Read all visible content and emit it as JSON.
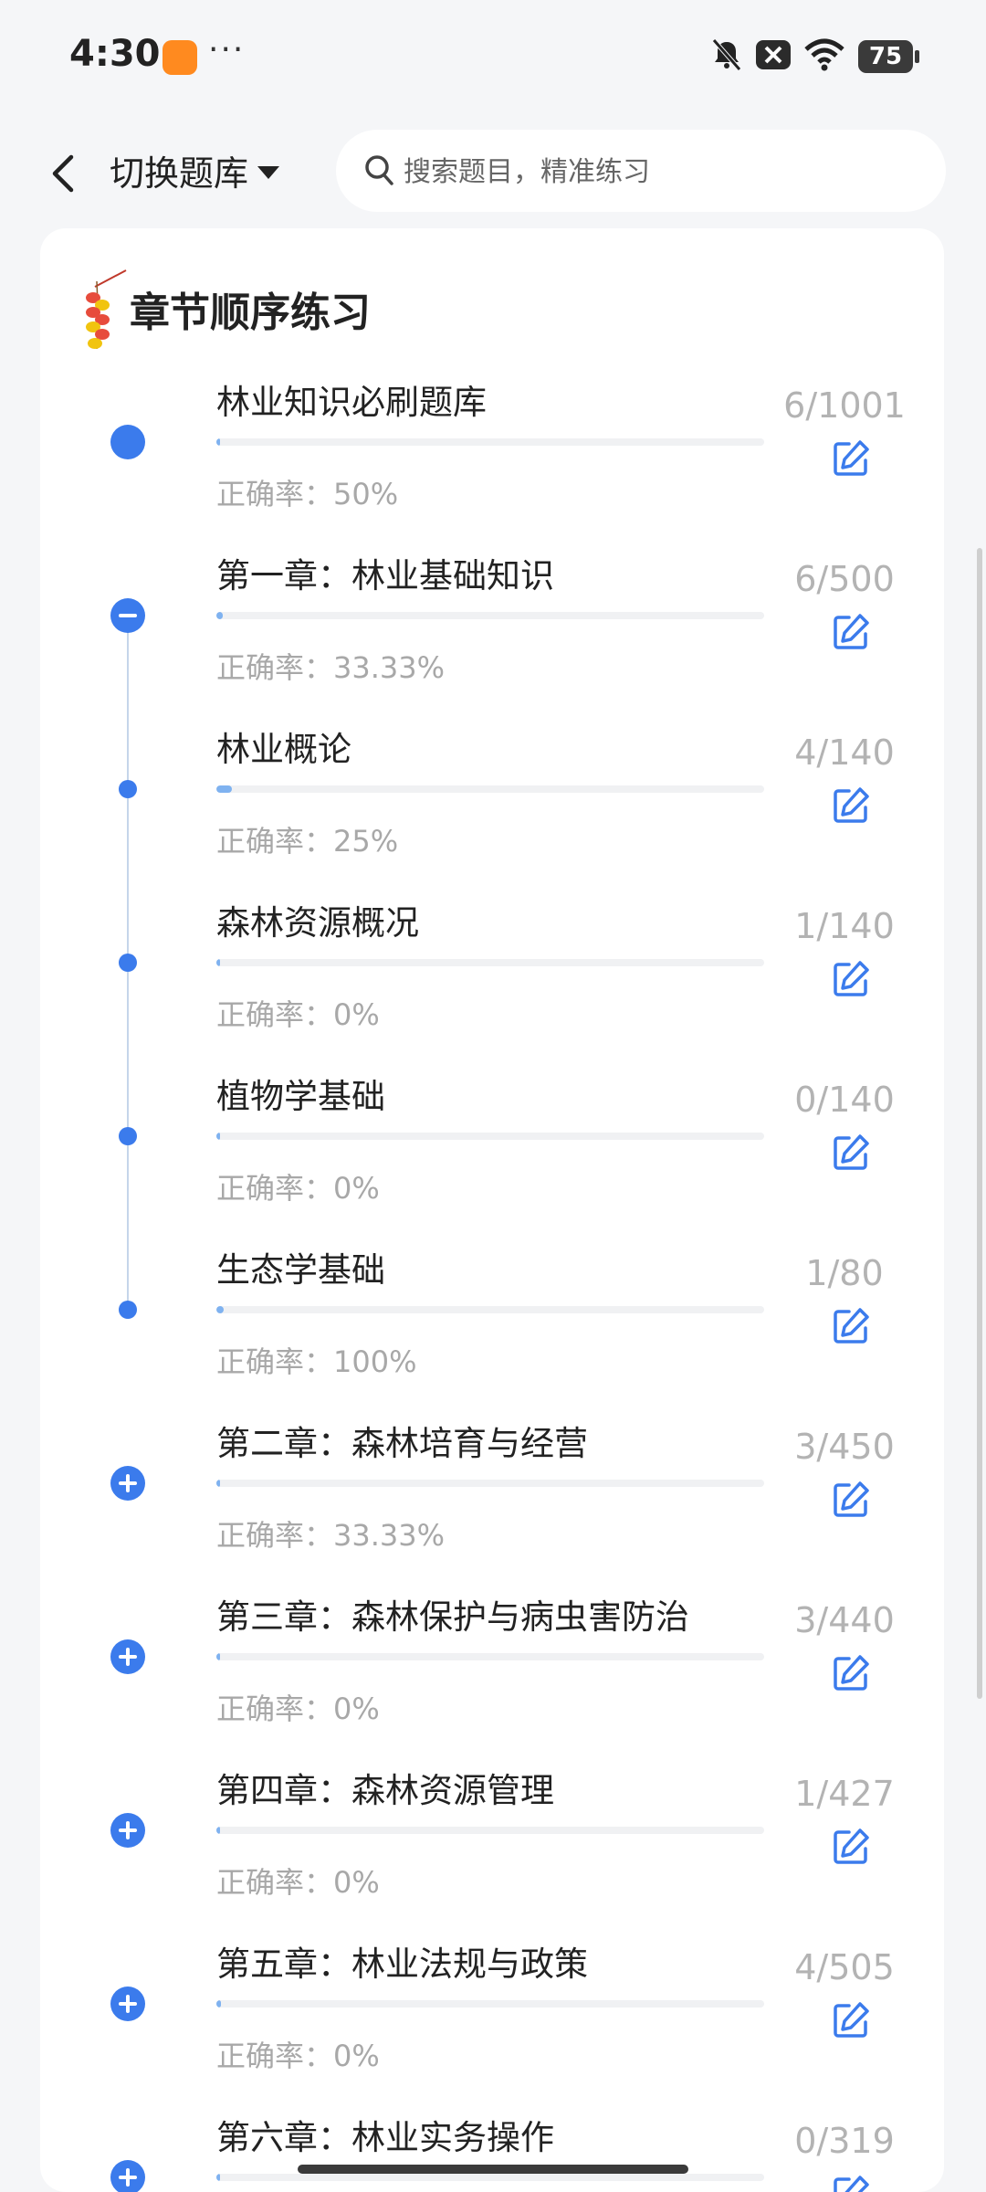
{
  "status_bar": {
    "time": "4:30",
    "more": "···",
    "battery": "75",
    "icons": [
      "bell-off-icon",
      "x-notification-icon",
      "wifi-icon",
      "battery-icon"
    ]
  },
  "header": {
    "back_icon": "chevron-left-icon",
    "switch_label": "切换题库",
    "search_placeholder": "搜索题目，精准练习"
  },
  "card": {
    "title": "章节顺序练习",
    "accuracy_label": "正确率："
  },
  "rows": [
    {
      "title": "林业知识必刷题库",
      "count": "6/1001",
      "accuracy": "正确率：50%",
      "progress": 0.006,
      "node": "big"
    },
    {
      "title": "第一章：林业基础知识",
      "count": "6/500",
      "accuracy": "正确率：33.33%",
      "progress": 0.012,
      "node": "minus"
    },
    {
      "title": "林业概论",
      "count": "4/140",
      "accuracy": "正确率：25%",
      "progress": 0.029,
      "node": "small"
    },
    {
      "title": "森林资源概况",
      "count": "1/140",
      "accuracy": "正确率：0%",
      "progress": 0.007,
      "node": "small"
    },
    {
      "title": "植物学基础",
      "count": "0/140",
      "accuracy": "正确率：0%",
      "progress": 0,
      "node": "small"
    },
    {
      "title": "生态学基础",
      "count": "1/80",
      "accuracy": "正确率：100%",
      "progress": 0.0125,
      "node": "small"
    },
    {
      "title": "第二章：森林培育与经营",
      "count": "3/450",
      "accuracy": "正确率：33.33%",
      "progress": 0.0067,
      "node": "plus"
    },
    {
      "title": "第三章：森林保护与病虫害防治",
      "count": "3/440",
      "accuracy": "正确率：0%",
      "progress": 0.0068,
      "node": "plus"
    },
    {
      "title": "第四章：森林资源管理",
      "count": "1/427",
      "accuracy": "正确率：0%",
      "progress": 0.0023,
      "node": "plus"
    },
    {
      "title": "第五章：林业法规与政策",
      "count": "4/505",
      "accuracy": "正确率：0%",
      "progress": 0.0079,
      "node": "plus"
    },
    {
      "title": "第六章：林业实务操作",
      "count": "0/319",
      "accuracy": "",
      "progress": 0,
      "node": "plus"
    }
  ],
  "colors": {
    "accent": "#3b7bec",
    "progress_fill": "#7fb2f0",
    "muted_text": "#a8a8a8",
    "background": "#f5f6f8"
  }
}
